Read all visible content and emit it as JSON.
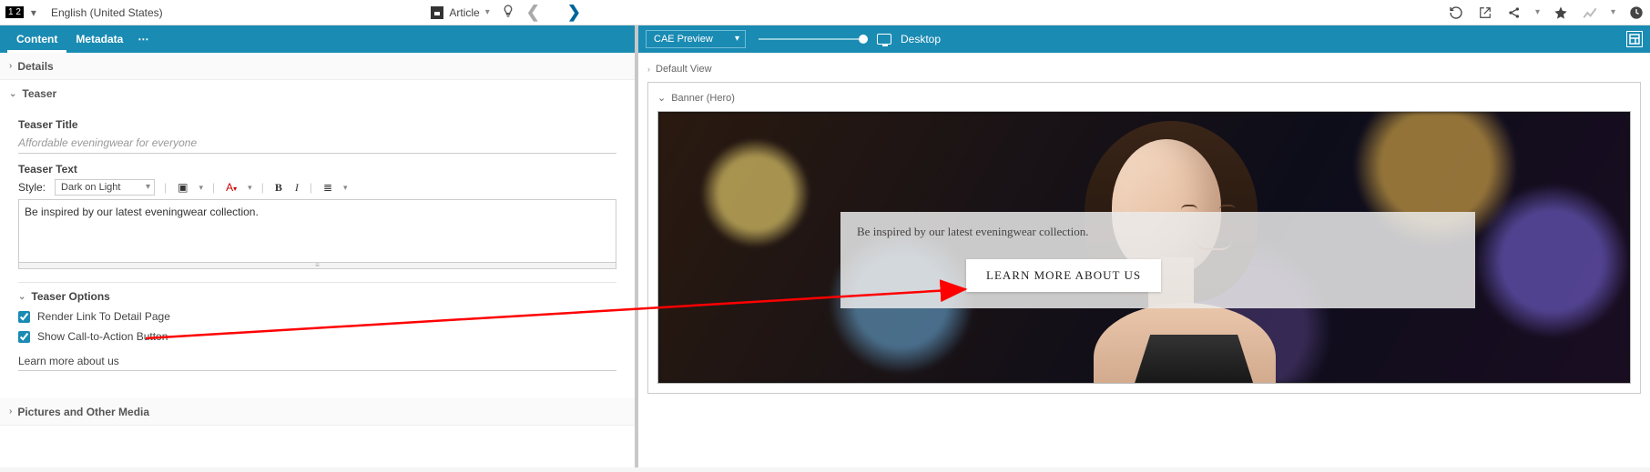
{
  "header": {
    "badge": "1 2",
    "language": "English (United States)",
    "type_label": "Article"
  },
  "editor": {
    "tabs": {
      "content": "Content",
      "metadata": "Metadata"
    },
    "sections": {
      "details": "Details",
      "teaser": "Teaser",
      "pictures": "Pictures and Other Media"
    },
    "teaser": {
      "title_label": "Teaser Title",
      "title_placeholder": "Affordable eveningwear for everyone",
      "text_label": "Teaser Text",
      "style_label": "Style:",
      "style_value": "Dark on Light",
      "body": "Be inspired by our latest eveningwear collection.",
      "options_label": "Teaser Options",
      "render_link_label": "Render Link To Detail Page",
      "render_link_checked": true,
      "show_cta_label": "Show Call-to-Action Button",
      "show_cta_checked": true,
      "cta_text": "Learn more about us"
    }
  },
  "preview": {
    "mode": "CAE Preview",
    "device": "Desktop",
    "default_view": "Default View",
    "banner_label": "Banner (Hero)",
    "hero_tagline": "Be inspired by our latest eveningwear collection.",
    "hero_cta": "LEARN MORE ABOUT US"
  }
}
